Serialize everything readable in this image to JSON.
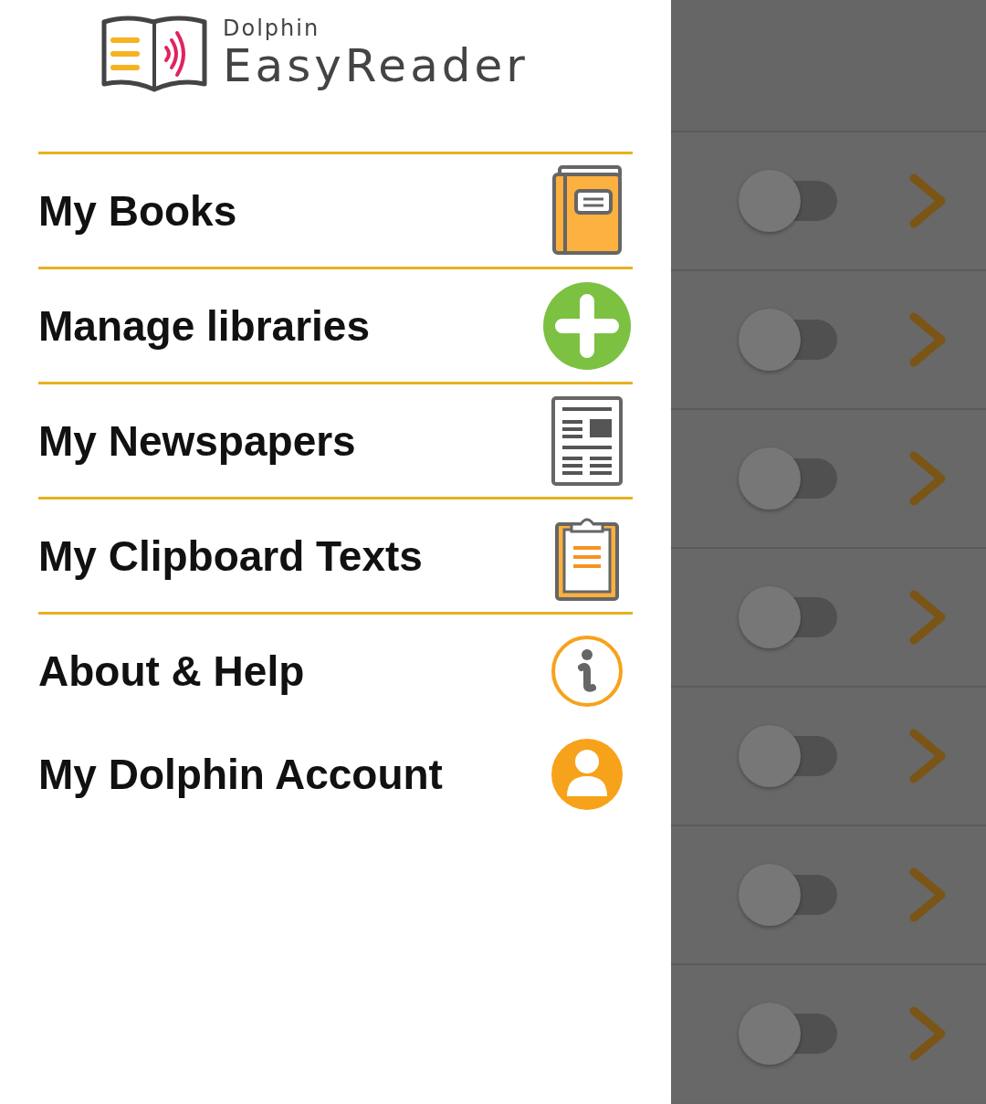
{
  "logo": {
    "brand": "Dolphin",
    "product": "EasyReader"
  },
  "menu": [
    {
      "label": "My Books",
      "kind": "book",
      "rule_above": true
    },
    {
      "label": "Manage libraries",
      "kind": "add",
      "rule_above": true
    },
    {
      "label": "My Newspapers",
      "kind": "newspaper",
      "rule_above": true
    },
    {
      "label": "My Clipboard Texts",
      "kind": "clipboard",
      "rule_above": true
    },
    {
      "label": "About & Help",
      "kind": "info",
      "rule_above": true
    },
    {
      "label": "My Dolphin Account",
      "kind": "account",
      "rule_above": false
    }
  ],
  "background_rows": [
    {
      "on": false
    },
    {
      "on": false
    },
    {
      "on": false
    },
    {
      "on": false
    },
    {
      "on": false
    },
    {
      "on": false
    },
    {
      "on": false
    }
  ]
}
